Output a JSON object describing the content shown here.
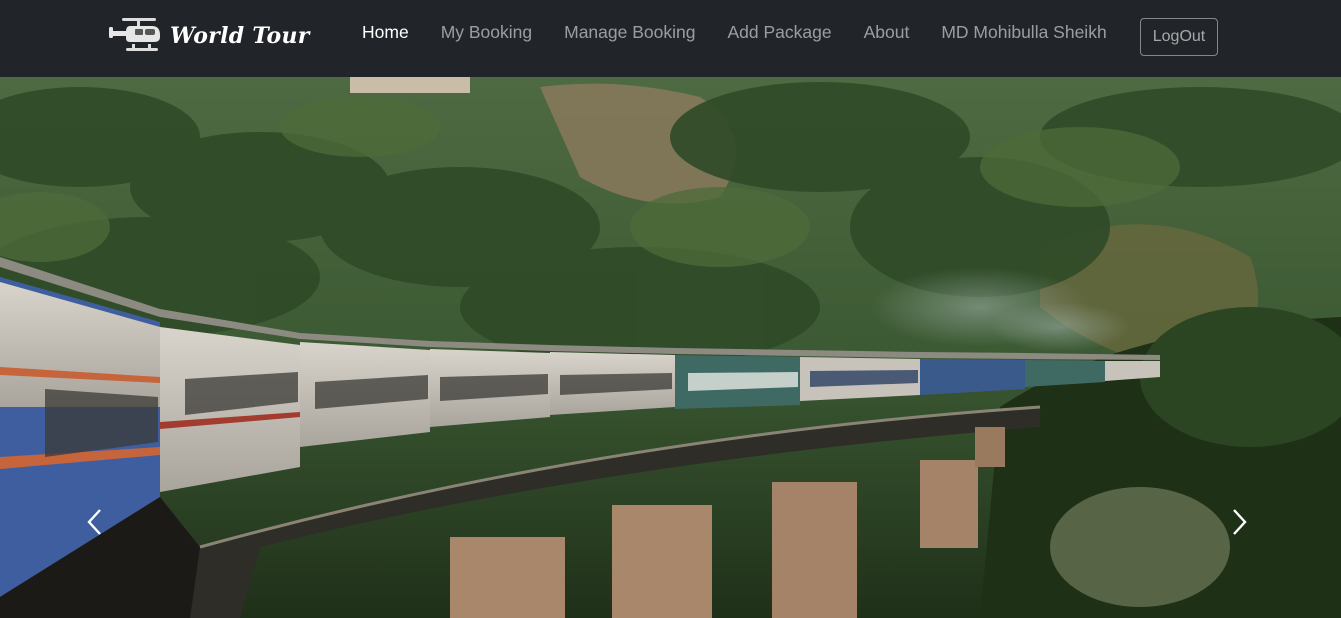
{
  "navbar": {
    "brand": {
      "icon": "helicopter-icon",
      "title": "World Tour"
    },
    "links": [
      {
        "label": "Home",
        "active": true
      },
      {
        "label": "My Booking",
        "active": false
      },
      {
        "label": "Manage Booking",
        "active": false
      },
      {
        "label": "Add Package",
        "active": false
      },
      {
        "label": "About",
        "active": false
      },
      {
        "label": "MD Mohibulla Sheikh",
        "active": false
      }
    ],
    "logout_label": "LogOut"
  },
  "carousel": {
    "slide_image": "train-on-bridge-through-forest",
    "prev_icon": "chevron-left-icon",
    "next_icon": "chevron-right-icon"
  },
  "colors": {
    "navbar_bg": "#212529",
    "nav_active": "#ffffff",
    "nav_inactive": "#8c8e91"
  }
}
